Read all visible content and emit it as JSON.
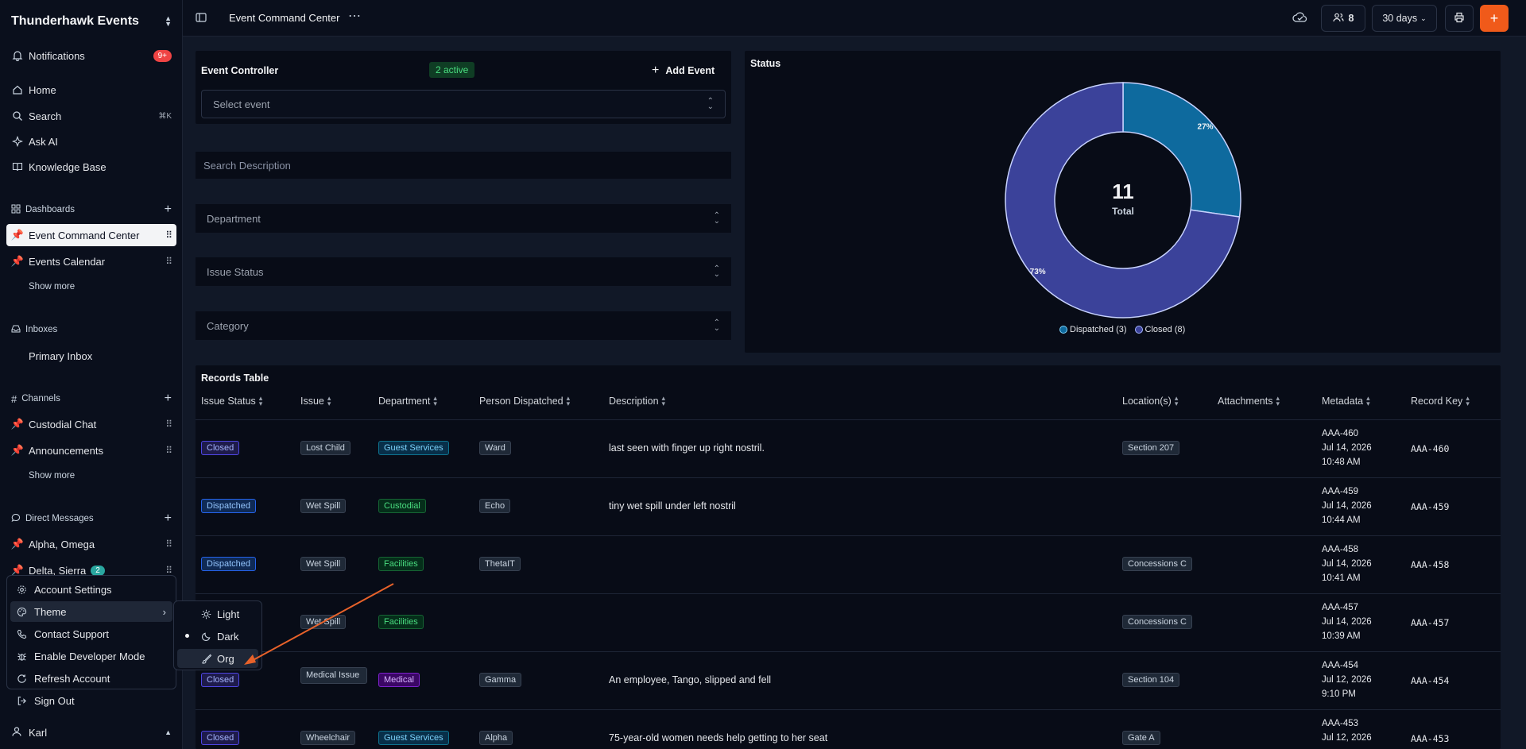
{
  "workspace": {
    "name": "Thunderhawk Events"
  },
  "sidebar": {
    "notifications": {
      "label": "Notifications",
      "badge": "9+"
    },
    "nav": [
      {
        "label": "Home",
        "icon": "home-icon"
      },
      {
        "label": "Search",
        "icon": "search-icon",
        "shortcut": "⌘K"
      },
      {
        "label": "Ask AI",
        "icon": "sparkle-icon"
      },
      {
        "label": "Knowledge Base",
        "icon": "book-icon"
      }
    ],
    "dashboards": {
      "title": "Dashboards",
      "items": [
        "Event Command Center",
        "Events Calendar"
      ],
      "show_more": "Show more"
    },
    "inboxes": {
      "title": "Inboxes",
      "items": [
        "Primary Inbox"
      ]
    },
    "channels": {
      "title": "Channels",
      "items": [
        "Custodial Chat",
        "Announcements"
      ],
      "show_more": "Show more"
    },
    "direct_messages": {
      "title": "Direct Messages",
      "items": [
        {
          "label": "Alpha, Omega"
        },
        {
          "label": "Delta, Sierra",
          "badge": "2"
        }
      ]
    },
    "user": {
      "name": "Karl"
    }
  },
  "user_menu": {
    "items": [
      "Account Settings",
      "Theme",
      "Contact Support",
      "Enable Developer Mode",
      "Refresh Account",
      "Sign Out"
    ],
    "theme_submenu": [
      "Light",
      "Dark",
      "Org"
    ],
    "selected_theme": "Dark"
  },
  "topbar": {
    "title": "Event Command Center",
    "members_count": "8",
    "range": "30 days"
  },
  "controller": {
    "title": "Event Controller",
    "active_badge": "2 active",
    "add_label": "Add Event",
    "select_placeholder": "Select event",
    "search_placeholder": "Search Description",
    "filters": [
      "Department",
      "Issue Status",
      "Category"
    ]
  },
  "status_panel": {
    "title": "Status"
  },
  "chart_data": {
    "type": "pie",
    "title": "Status",
    "center_value": "11",
    "center_label": "Total",
    "slices": [
      {
        "label": "Dispatched (3)",
        "value": 3,
        "percent": "27%",
        "color": "#0e6a9e"
      },
      {
        "label": "Closed (8)",
        "value": 8,
        "percent": "73%",
        "color": "#3b429a"
      }
    ]
  },
  "records": {
    "title": "Records Table",
    "columns": [
      "Issue Status",
      "Issue",
      "Department",
      "Person Dispatched",
      "Description",
      "Location(s)",
      "Attachments",
      "Metadata",
      "Record Key"
    ],
    "rows": [
      {
        "status": "Closed",
        "status_type": "closed",
        "issue": "Lost Child",
        "dept": "Guest Services",
        "dept_type": "blue",
        "person": "Ward",
        "desc": "last seen with finger up right nostril.",
        "loc": "Section 207",
        "meta_id": "AAA-460",
        "meta_date": "Jul 14, 2026",
        "meta_time": "10:48 AM",
        "key": "AAA-460"
      },
      {
        "status": "Dispatched",
        "status_type": "disp",
        "issue": "Wet Spill",
        "dept": "Custodial",
        "dept_type": "green",
        "person": "Echo",
        "desc": "tiny wet spill under left nostril",
        "loc": "",
        "meta_id": "AAA-459",
        "meta_date": "Jul 14, 2026",
        "meta_time": "10:44 AM",
        "key": "AAA-459"
      },
      {
        "status": "Dispatched",
        "status_type": "disp",
        "issue": "Wet Spill",
        "dept": "Facilities",
        "dept_type": "green",
        "person": "ThetaIT",
        "desc": "",
        "loc": "Concessions C",
        "meta_id": "AAA-458",
        "meta_date": "Jul 14, 2026",
        "meta_time": "10:41 AM",
        "key": "AAA-458"
      },
      {
        "status": "",
        "status_type": "closed",
        "issue": "Wet Spill",
        "dept": "Facilities",
        "dept_type": "green",
        "person": "",
        "desc": "",
        "loc": "Concessions C",
        "meta_id": "AAA-457",
        "meta_date": "Jul 14, 2026",
        "meta_time": "10:39 AM",
        "key": "AAA-457"
      },
      {
        "status": "Closed",
        "status_type": "closed",
        "issue": "Medical Issue",
        "dept": "Medical",
        "dept_type": "purple",
        "person": "Gamma",
        "desc": "An employee, Tango, slipped and fell",
        "loc": "Section 104",
        "meta_id": "AAA-454",
        "meta_date": "Jul 12, 2026",
        "meta_time": "9:10 PM",
        "key": "AAA-454"
      },
      {
        "status": "Closed",
        "status_type": "closed",
        "issue": "Wheelchair",
        "dept": "Guest Services",
        "dept_type": "blue",
        "person": "Alpha",
        "desc": "75-year-old women needs help getting to her seat",
        "loc": "Gate A",
        "meta_id": "AAA-453",
        "meta_date": "Jul 12, 2026",
        "meta_time": "",
        "key": "AAA-453"
      }
    ]
  },
  "annotation": {
    "arrow_color": "#e8622a"
  }
}
